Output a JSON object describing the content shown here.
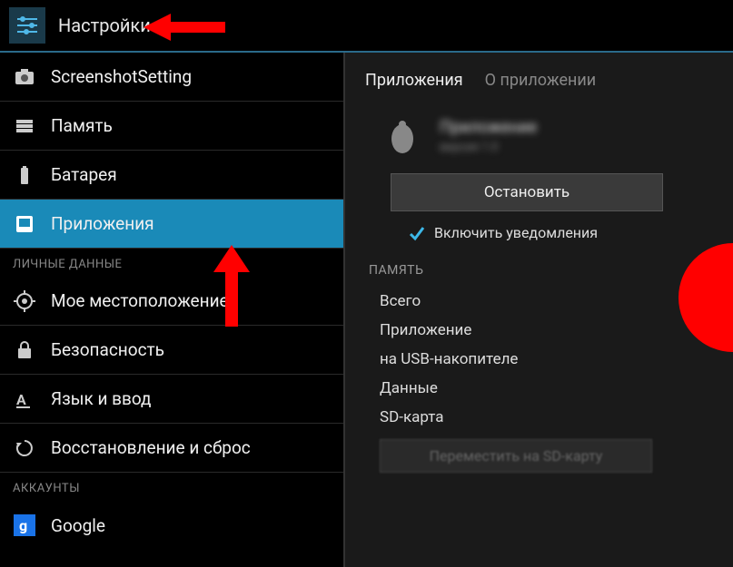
{
  "header": {
    "title": "Настройки"
  },
  "sidebar": {
    "items": [
      {
        "label": "ScreenshotSetting",
        "icon": "camera"
      },
      {
        "label": "Память",
        "icon": "storage"
      },
      {
        "label": "Батарея",
        "icon": "battery"
      },
      {
        "label": "Приложения",
        "icon": "apps",
        "selected": true
      }
    ],
    "section_personal": "ЛИЧНЫЕ ДАННЫЕ",
    "items_personal": [
      {
        "label": "Мое местоположение",
        "icon": "location"
      },
      {
        "label": "Безопасность",
        "icon": "lock"
      },
      {
        "label": "Язык и ввод",
        "icon": "language"
      },
      {
        "label": "Восстановление и сброс",
        "icon": "reset"
      }
    ],
    "section_accounts": "АККАУНТЫ",
    "items_accounts": [
      {
        "label": "Google",
        "icon": "google"
      }
    ]
  },
  "detail": {
    "tabs": [
      {
        "label": "Приложения",
        "active": true
      },
      {
        "label": "О приложении",
        "active": false
      }
    ],
    "app": {
      "name": "Приложение",
      "sub": "версия 1.0"
    },
    "action_button": "Остановить",
    "checkbox_label": "Включить уведомления",
    "memory_section": "ПАМЯТЬ",
    "memory_rows": [
      "Всего",
      "Приложение",
      "на USB-накопителе",
      "Данные",
      "SD-карта"
    ],
    "move_button": "Переместить на SD-карту"
  }
}
